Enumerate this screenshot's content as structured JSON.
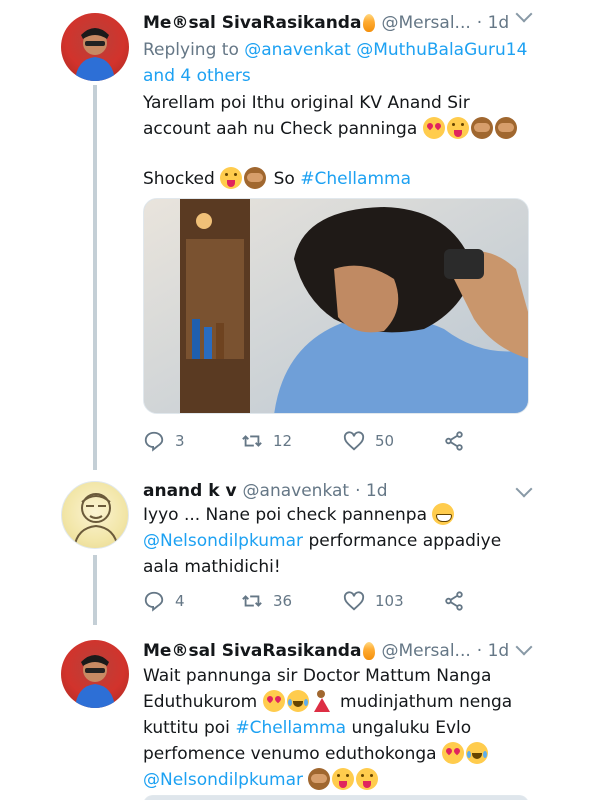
{
  "tweets": [
    {
      "name": "Me®sal SivaRasikanda",
      "handle": "@Mersal...",
      "time": "· 1d",
      "reply_prefix": "Replying to",
      "reply_to_1": "@anavenkat",
      "reply_to_2": "@MuthuBalaGuru14",
      "reply_others": "and 4 others",
      "text_line1": "Yarellam poi Ithu original KV Anand Sir",
      "text_line2": "account aah nu Check panninga",
      "text_shocked": "Shocked",
      "text_so": "So",
      "hashtag": "#Chellamma",
      "reply_count": "3",
      "retweet_count": "12",
      "like_count": "50"
    },
    {
      "name": "anand k v",
      "handle": "@anavenkat",
      "time": "· 1d",
      "text_line1": "Iyyo ... Nane poi check pannenpa",
      "mention": "@Nelsondilpkumar",
      "text_line2_rest": "performance appadiye",
      "text_line3": "aala mathidichi!",
      "reply_count": "4",
      "retweet_count": "36",
      "like_count": "103"
    },
    {
      "name": "Me®sal SivaRasikanda",
      "handle": "@Mersal...",
      "time": "· 1d",
      "text_line1": "Wait pannunga sir Doctor Mattum Nanga",
      "text_line2a": "Eduthukurom",
      "text_line2b": "mudinjathum nenga",
      "text_line3a": "kuttitu poi",
      "hashtag": "#Chellamma",
      "text_line3b": "ungaluku Evlo",
      "text_line4": "perfomence venumo eduthokonga",
      "mention": "@Nelsondilpkumar"
    }
  ],
  "icons": {
    "reply": "reply-icon",
    "retweet": "retweet-icon",
    "like": "heart-icon",
    "share": "share-icon",
    "more": "chevron-down-icon"
  },
  "colors": {
    "link": "#1da1f2",
    "muted": "#657786",
    "thread_line": "#c4cfd6"
  }
}
